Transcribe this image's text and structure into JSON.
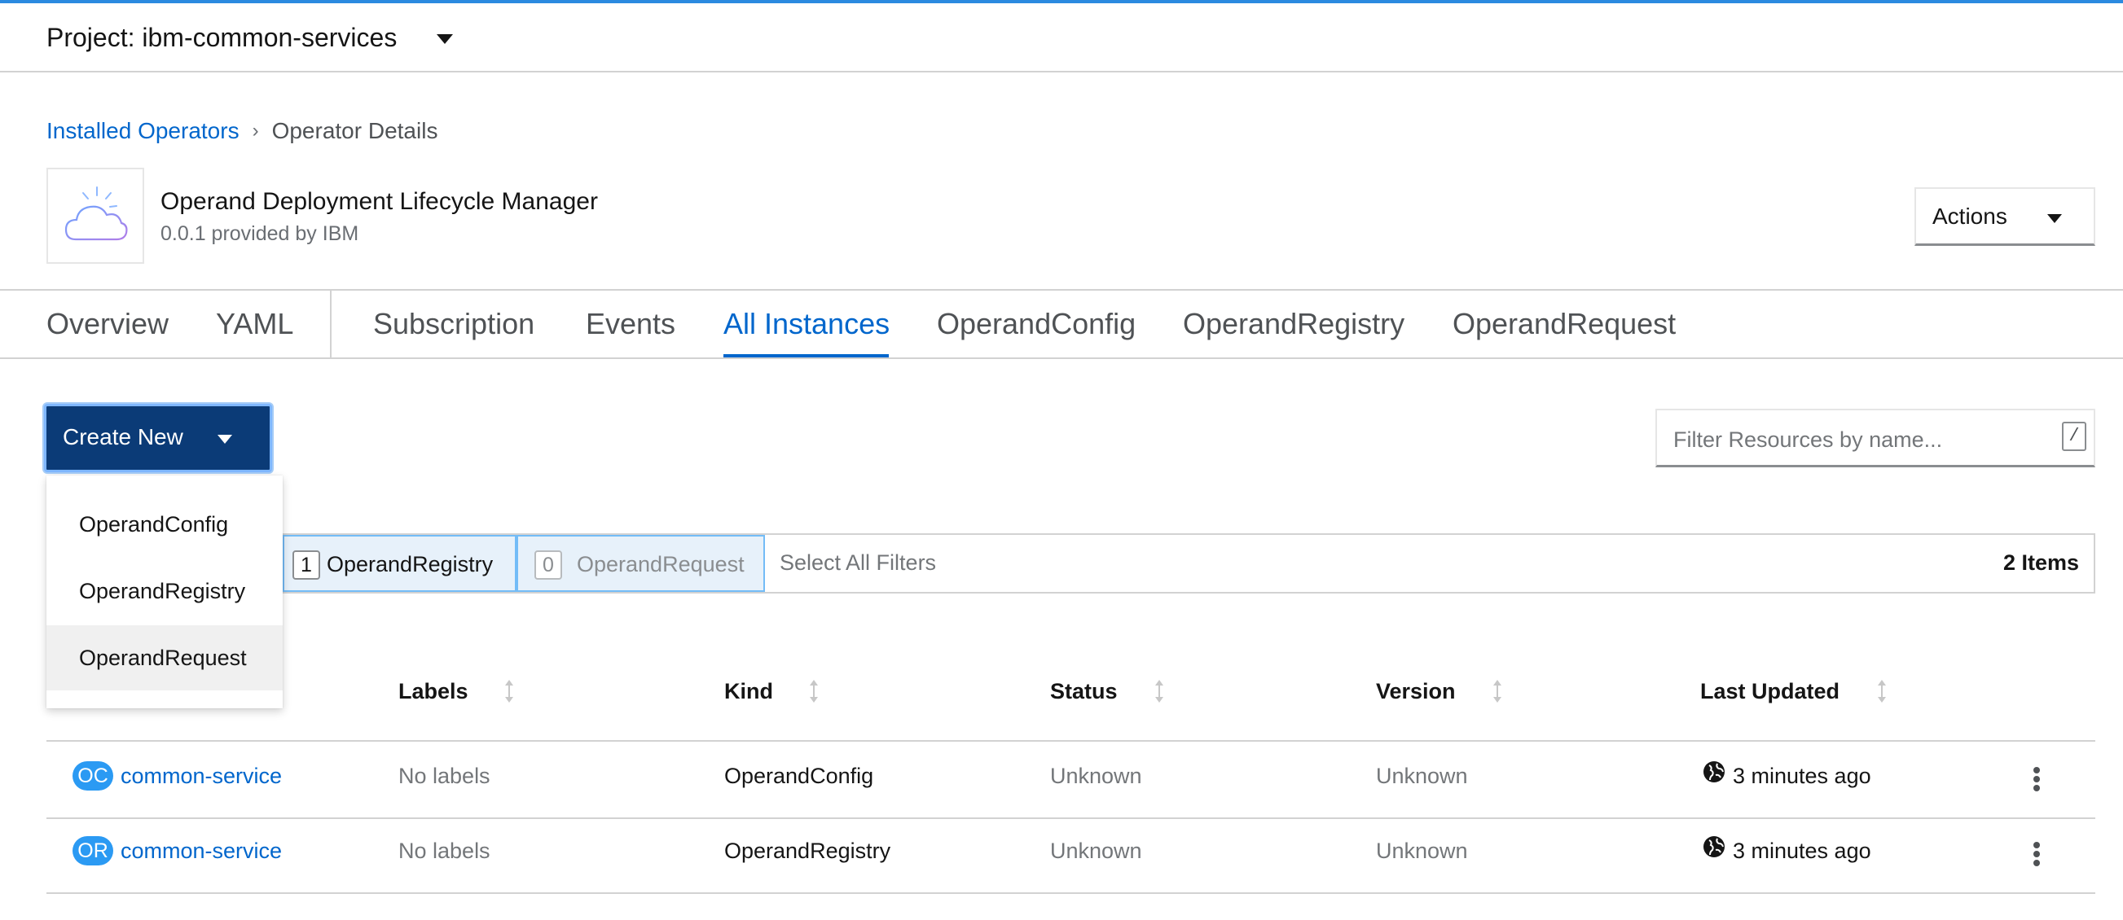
{
  "colors": {
    "accent": "#0066cc",
    "primary_button": "#0b3b77",
    "badge": "#2b9af3",
    "chip_bg": "#e7f1fa"
  },
  "project": {
    "label": "Project: ibm-common-services",
    "icon": "chevron-down-icon"
  },
  "breadcrumb": {
    "parent": "Installed Operators",
    "separator": "›",
    "current": "Operator Details"
  },
  "operator": {
    "name": "Operand Deployment Lifecycle Manager",
    "subtitle": "0.0.1 provided by IBM",
    "logo_icon": "cloud-icon"
  },
  "actions": {
    "label": "Actions"
  },
  "tabs": [
    {
      "label": "Overview"
    },
    {
      "label": "YAML"
    },
    {
      "label": "Subscription"
    },
    {
      "label": "Events"
    },
    {
      "label": "All Instances",
      "active": true
    },
    {
      "label": "OperandConfig"
    },
    {
      "label": "OperandRegistry"
    },
    {
      "label": "OperandRequest"
    }
  ],
  "create": {
    "label": "Create New",
    "menu": [
      {
        "label": "OperandConfig"
      },
      {
        "label": "OperandRegistry"
      },
      {
        "label": "OperandRequest",
        "hovered": true
      }
    ]
  },
  "filter": {
    "placeholder": "Filter Resources by name...",
    "shortcut": "/"
  },
  "chips": [
    {
      "count": "1",
      "label": "OperandRegistry",
      "active": true
    },
    {
      "count": "0",
      "label": "OperandRequest",
      "active": false
    }
  ],
  "select_all": "Select All Filters",
  "item_count": "2 Items",
  "table": {
    "columns": [
      "Labels",
      "Kind",
      "Status",
      "Version",
      "Last Updated"
    ],
    "rows": [
      {
        "badge": "OC",
        "name": "common-service",
        "labels": "No labels",
        "kind": "OperandConfig",
        "status": "Unknown",
        "version": "Unknown",
        "updated": "3 minutes ago"
      },
      {
        "badge": "OR",
        "name": "common-service",
        "labels": "No labels",
        "kind": "OperandRegistry",
        "status": "Unknown",
        "version": "Unknown",
        "updated": "3 minutes ago"
      }
    ]
  }
}
